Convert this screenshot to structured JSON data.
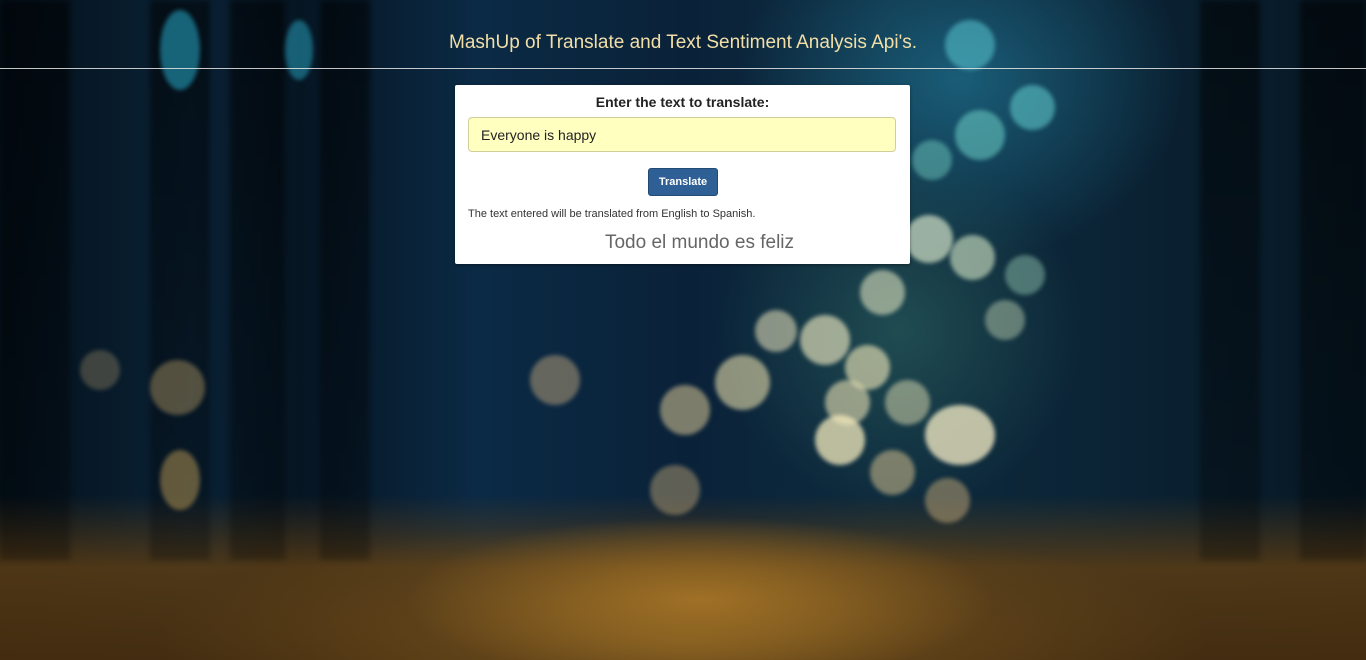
{
  "header": {
    "title": "MashUp of Translate and Text Sentiment Analysis Api's."
  },
  "form": {
    "label": "Enter the text to translate:",
    "input_value": "Everyone is happy",
    "button_label": "Translate",
    "note": "The text entered will be translated from English to Spanish.",
    "result": "Todo el mundo es feliz"
  },
  "colors": {
    "header_text": "#f2dfa8",
    "button_bg": "#2e5f95",
    "input_bg": "#ffffc0"
  }
}
